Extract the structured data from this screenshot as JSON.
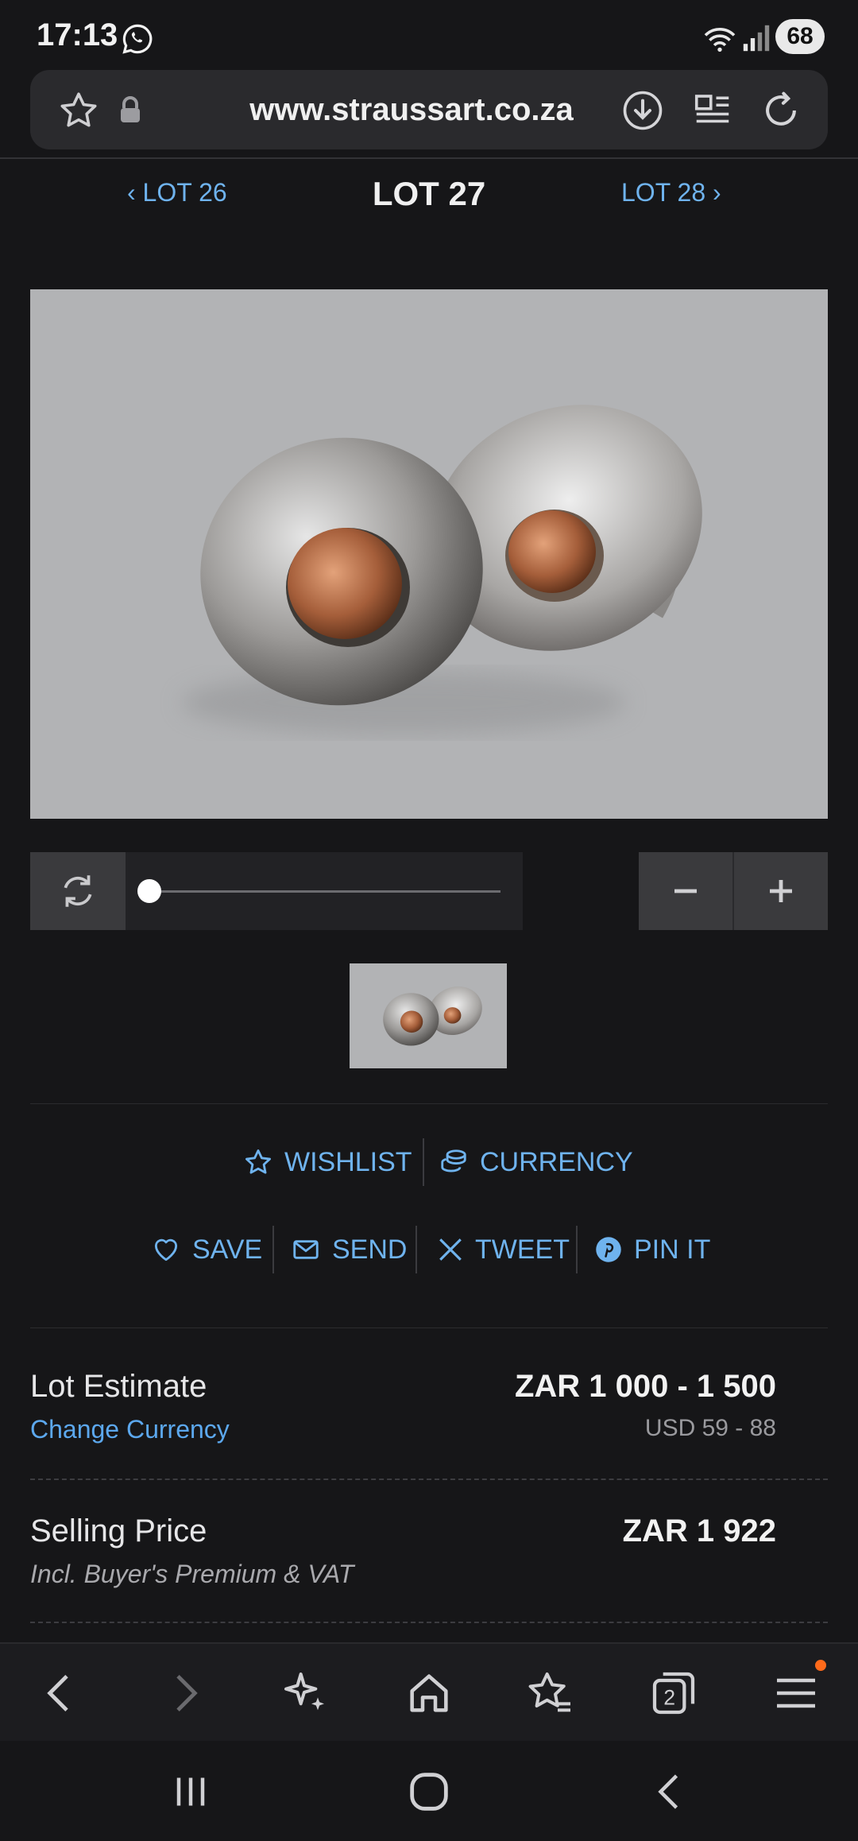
{
  "status_bar": {
    "time": "17:13",
    "battery": "68",
    "icons": [
      "whatsapp-icon",
      "wifi-icon",
      "signal-icon"
    ]
  },
  "browser": {
    "url": "www.straussart.co.za"
  },
  "lot_nav": {
    "prev": "LOT 26",
    "current": "LOT 27",
    "next": "LOT 28"
  },
  "viewer": {
    "zoom_level": 0,
    "zoom_out": "−",
    "zoom_in": "+"
  },
  "actions": {
    "wishlist": "WISHLIST",
    "currency": "CURRENCY",
    "save": "SAVE",
    "send": "SEND",
    "tweet": "TWEET",
    "pin": "PIN IT"
  },
  "pricing": {
    "estimate_label": "Lot Estimate",
    "change_currency": "Change Currency",
    "estimate_value": "ZAR 1 000 - 1 500",
    "estimate_usd": "USD 59 - 88",
    "selling_label": "Selling Price",
    "selling_value": "ZAR 1 922",
    "premium_note": "Incl. Buyer's Premium & VAT"
  },
  "toolbar": {
    "tab_count": "2"
  },
  "colors": {
    "accent": "#6fb3ee",
    "background": "#161618",
    "notification": "#ff6a1a"
  }
}
